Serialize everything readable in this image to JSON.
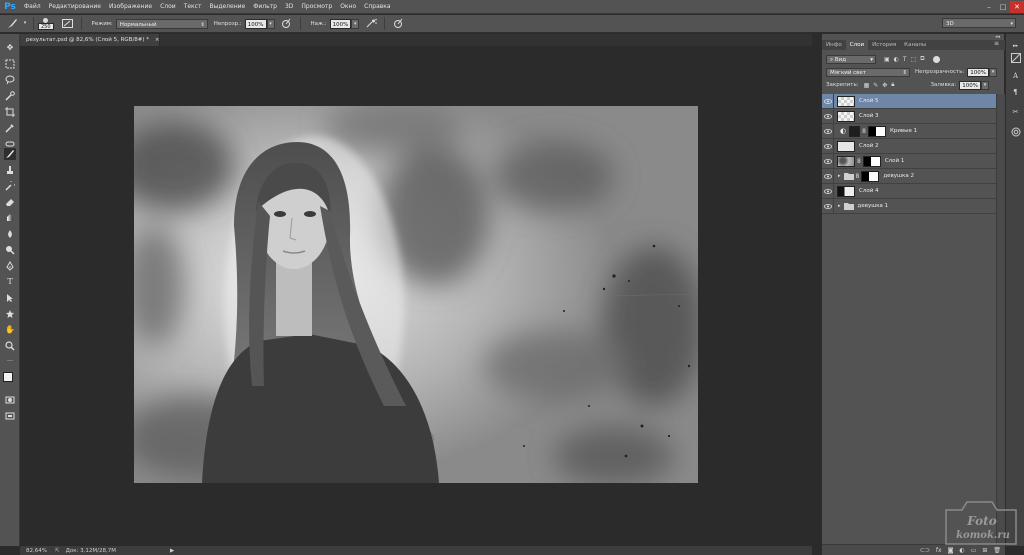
{
  "app": {
    "logo": "Ps"
  },
  "menu": [
    "Файл",
    "Редактирование",
    "Изображение",
    "Слои",
    "Текст",
    "Выделение",
    "Фильтр",
    "3D",
    "Просмотр",
    "Окно",
    "Справка"
  ],
  "options": {
    "brush_size": "250",
    "mode_label": "Режим:",
    "mode_value": "Нормальный",
    "opacity_label": "Непрозр.:",
    "opacity_value": "100%",
    "flow_label": "Наж.:",
    "flow_value": "100%",
    "workspace": "3D"
  },
  "document": {
    "tab_title": "результат.psd @ 82,6% (Слой 5, RGB/8#) *",
    "tab_close": "×"
  },
  "status": {
    "zoom": "82,64%",
    "doc_size": "Док: 3,12M/28,7M"
  },
  "panel": {
    "tabs": [
      "Инфо",
      "Слои",
      "История",
      "Каналы"
    ],
    "active_tab": 1,
    "filter_kind": "Вид",
    "blend_mode": "Мягкий свет",
    "opacity_label": "Непрозрачность:",
    "opacity_value": "100%",
    "lock_label": "Закрепить:",
    "fill_label": "Заливка:",
    "fill_value": "100%"
  },
  "layers": [
    {
      "name": "Слой 5",
      "selected": true,
      "thumb": "checker",
      "group": false,
      "mask": false,
      "adjust": false
    },
    {
      "name": "Слой 3",
      "selected": false,
      "thumb": "checker",
      "group": false,
      "mask": false,
      "adjust": false
    },
    {
      "name": "Кривые 1",
      "selected": false,
      "thumb": "curves",
      "group": false,
      "mask": true,
      "adjust": true
    },
    {
      "name": "Слой 2",
      "selected": false,
      "thumb": "light",
      "group": false,
      "mask": false,
      "adjust": false
    },
    {
      "name": "Слой 1",
      "selected": false,
      "thumb": "texture",
      "group": false,
      "mask": true,
      "adjust": false
    },
    {
      "name": "девушка 2",
      "selected": false,
      "thumb": "folder",
      "group": true,
      "mask": true,
      "adjust": false
    },
    {
      "name": "Слой 4",
      "selected": false,
      "thumb": "portrait",
      "group": false,
      "mask": false,
      "adjust": false
    },
    {
      "name": "девушка 1",
      "selected": false,
      "thumb": "folder",
      "group": true,
      "mask": false,
      "adjust": false
    }
  ],
  "watermark": {
    "line1": "Foto",
    "line2": "komok.ru"
  },
  "colors": {
    "chrome": "#535353",
    "canvas_bg": "#2b2b2b",
    "selection": "#6e87a8",
    "accent": "#31a8ff"
  }
}
